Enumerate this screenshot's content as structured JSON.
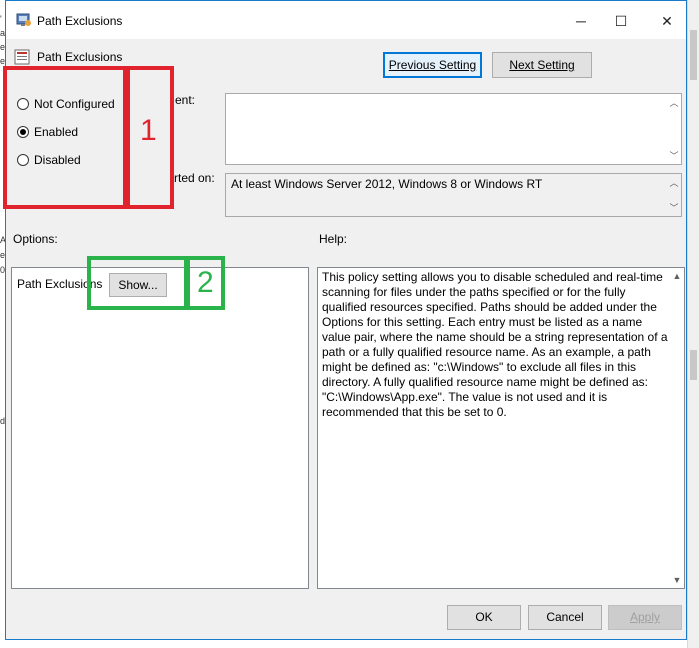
{
  "window": {
    "title": "Path Exclusions",
    "policy_name": "Path Exclusions",
    "minimize_glyph": "─",
    "maximize_glyph": "☐",
    "close_glyph": "✕"
  },
  "nav": {
    "previous_label": "Previous Setting",
    "next_label": "Next Setting"
  },
  "state": {
    "options": [
      {
        "label": "Not Configured",
        "selected": false
      },
      {
        "label": "Enabled",
        "selected": true
      },
      {
        "label": "Disabled",
        "selected": false
      }
    ]
  },
  "comment": {
    "label_fragment": "ent:",
    "value": ""
  },
  "supported_on": {
    "label_fragment": "rted on:",
    "value": "At least Windows Server 2012, Windows 8 or Windows RT"
  },
  "options_section": {
    "heading": "Options:",
    "path_exclusions_label": "Path Exclusions",
    "show_button_label": "Show..."
  },
  "help_section": {
    "heading": "Help:",
    "text": "This policy setting allows you to disable scheduled and real-time scanning for files under the paths specified or for the fully qualified resources specified. Paths should be added under the Options for this setting. Each entry must be listed as a name value pair, where the name should be a string representation of a path or a fully qualified resource name. As an example, a path might be defined as: \"c:\\Windows\" to exclude all files in this directory. A fully qualified resource name might be defined as: \"C:\\Windows\\App.exe\". The value is not used and it is recommended that this be set to 0."
  },
  "footer": {
    "ok_label": "OK",
    "cancel_label": "Cancel",
    "apply_label": "Apply"
  },
  "annotations": {
    "marker_1": "1",
    "marker_2": "2",
    "marker_1_color": "#e1232d",
    "marker_2_color": "#29b34a"
  },
  "background_window": {
    "fragments": [
      "'",
      "a",
      "e",
      "e",
      "A",
      "e",
      "0",
      "da"
    ]
  }
}
